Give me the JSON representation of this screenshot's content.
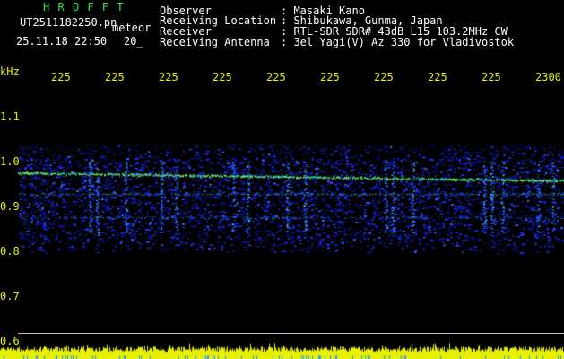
{
  "header": {
    "title": "H R O F F T",
    "filename": "UT2511182250.pn",
    "mode": "meteor",
    "datetime": "25.11.18 22:50",
    "page": "20_",
    "fields": [
      {
        "label": "Observer",
        "value": ": Masaki Kano"
      },
      {
        "label": "Receiving Location",
        "value": ": Shibukawa, Gunma, Japan"
      },
      {
        "label": "Receiver",
        "value": ": RTL-SDR SDR# 43dB L15 103.2MHz CW"
      },
      {
        "label": "Receiving Antenna",
        "value": ": 3el Yagi(V) Az 330 for Vladivostok"
      }
    ]
  },
  "axis": {
    "unit": "kHz",
    "y_ticks": [
      "1.1",
      "1.0",
      "0.9",
      "0.8",
      "0.7",
      "0.6"
    ],
    "x_ticks": [
      "225",
      "225",
      "225",
      "225",
      "225",
      "225",
      "225",
      "225",
      "225",
      "2300"
    ]
  },
  "colors": {
    "header_title": "#35e24a",
    "header_text": "#ffffff",
    "axis_text": "#e6f000",
    "signal_line": "#e8ff00",
    "noise_blue": "#1e33ff"
  }
}
